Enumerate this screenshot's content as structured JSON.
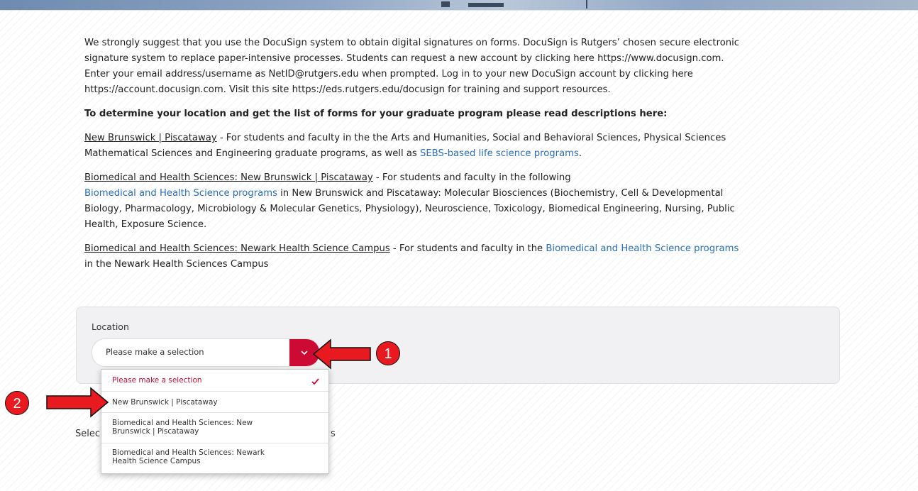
{
  "intro": {
    "line1": "We strongly suggest that you use the DocuSign system to obtain digital signatures on forms. DocuSign is Rutgers’ chosen secure electronic",
    "line2": "signature system to replace paper-intensive processes.  Students can request a new account by clicking here https://www.docusign.com.",
    "line3": "Enter your email address/username as NetID@rutgers.edu when prompted. Log in to your new DocuSign account by clicking here",
    "line4": "https://account.docusign.com. Visit this site https://eds.rutgers.edu/docusign for training and support resources."
  },
  "heading": "To determine your location and get the list of forms for your graduate program please read descriptions here:",
  "sections": {
    "nb_link": "New Brunswick | Piscataway",
    "nb_text1": " - For students and faculty in the the Arts and Humanities, Social and Behavioral Sciences, Physical Sciences",
    "nb_text2": "Mathematical Sciences and Engineering graduate programs, as well as ",
    "nb_blue": "SEBS-based life science programs",
    "nb_end": ".",
    "bhs_link": "Biomedical and Health Sciences: New Brunswick | Piscataway",
    "bhs_text1": " - For students and faculty in the following",
    "bhs_blue": "Biomedical and Health Science programs",
    "bhs_text2": " in New Brunswick and Piscataway: Molecular Biosciences (Biochemistry, Cell & Developmental",
    "bhs_text3": "Biology, Pharmacology, Microbiology & Molecular Genetics, Physiology), Neuroscience, Toxicology, Biomedical Engineering, Nursing, Public",
    "bhs_text4": "Health, Exposure Science.",
    "newark_link": "Biomedical and Health Sciences: Newark Health Science Campus",
    "newark_text1": " - For students and faculty in the ",
    "newark_blue": "Biomedical and Health Science programs",
    "newark_text2": "in the Newark Health Sciences Campus"
  },
  "location": {
    "label": "Location",
    "selected": "Please make a selection",
    "options": [
      {
        "line1": "Please make a selection",
        "line2": ""
      },
      {
        "line1": "New Brunswick | Piscataway",
        "line2": ""
      },
      {
        "line1": "Biomedical and Health Sciences: New",
        "line2": "Brunswick | Piscataway"
      },
      {
        "line1": "Biomedical and Health Sciences: Newark",
        "line2": "Health Science Campus"
      }
    ]
  },
  "select_caption_left": "Selec",
  "select_caption_right": "s",
  "markers": {
    "one": "1",
    "two": "2"
  },
  "colors": {
    "accent": "#cc0a33",
    "link_blue": "#2a6ebb",
    "annotation_red": "#e8191f"
  }
}
